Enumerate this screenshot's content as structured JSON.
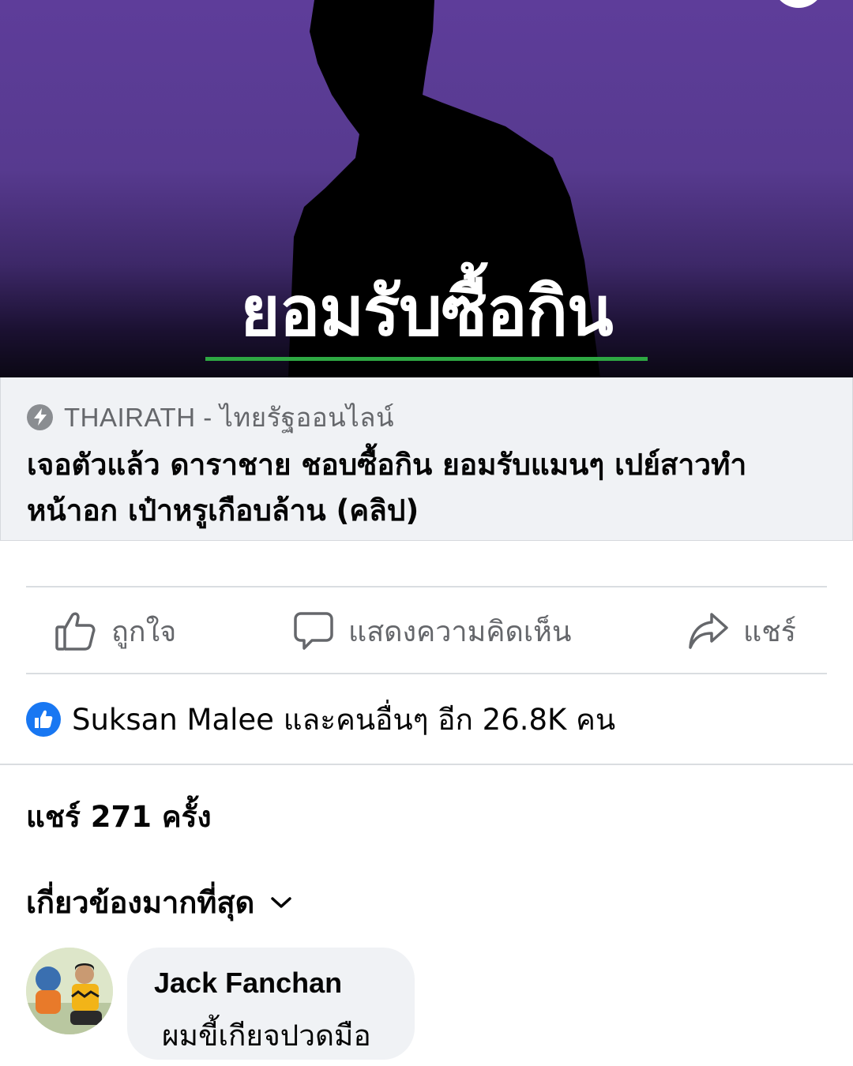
{
  "hero": {
    "headline": "ยอมรับซื้อกิน",
    "accent_color": "#2ea843"
  },
  "link_card": {
    "source": "THAIRATH - ไทยรัฐออนไลน์",
    "title": "เจอตัวแล้ว ดาราชาย ชอบซื้อกิน ยอมรับแมนๆ เปย์สาวทำหน้าอก เป๋าหรูเกือบล้าน (คลิป)",
    "source_icon": "bolt-icon"
  },
  "actions": {
    "like_label": "ถูกใจ",
    "comment_label": "แสดงความคิดเห็น",
    "share_label": "แชร์"
  },
  "reactions": {
    "summary": "Suksan Malee และคนอื่นๆ อีก 26.8K คน",
    "badge_color": "#1877f2"
  },
  "shares": {
    "text": "แชร์ 271 ครั้ง"
  },
  "comments": {
    "sort_label": "เกี่ยวข้องมากที่สุด",
    "items": [
      {
        "author": "Jack Fanchan",
        "text": "ผมขี้เกียจปวดมือ"
      }
    ]
  }
}
